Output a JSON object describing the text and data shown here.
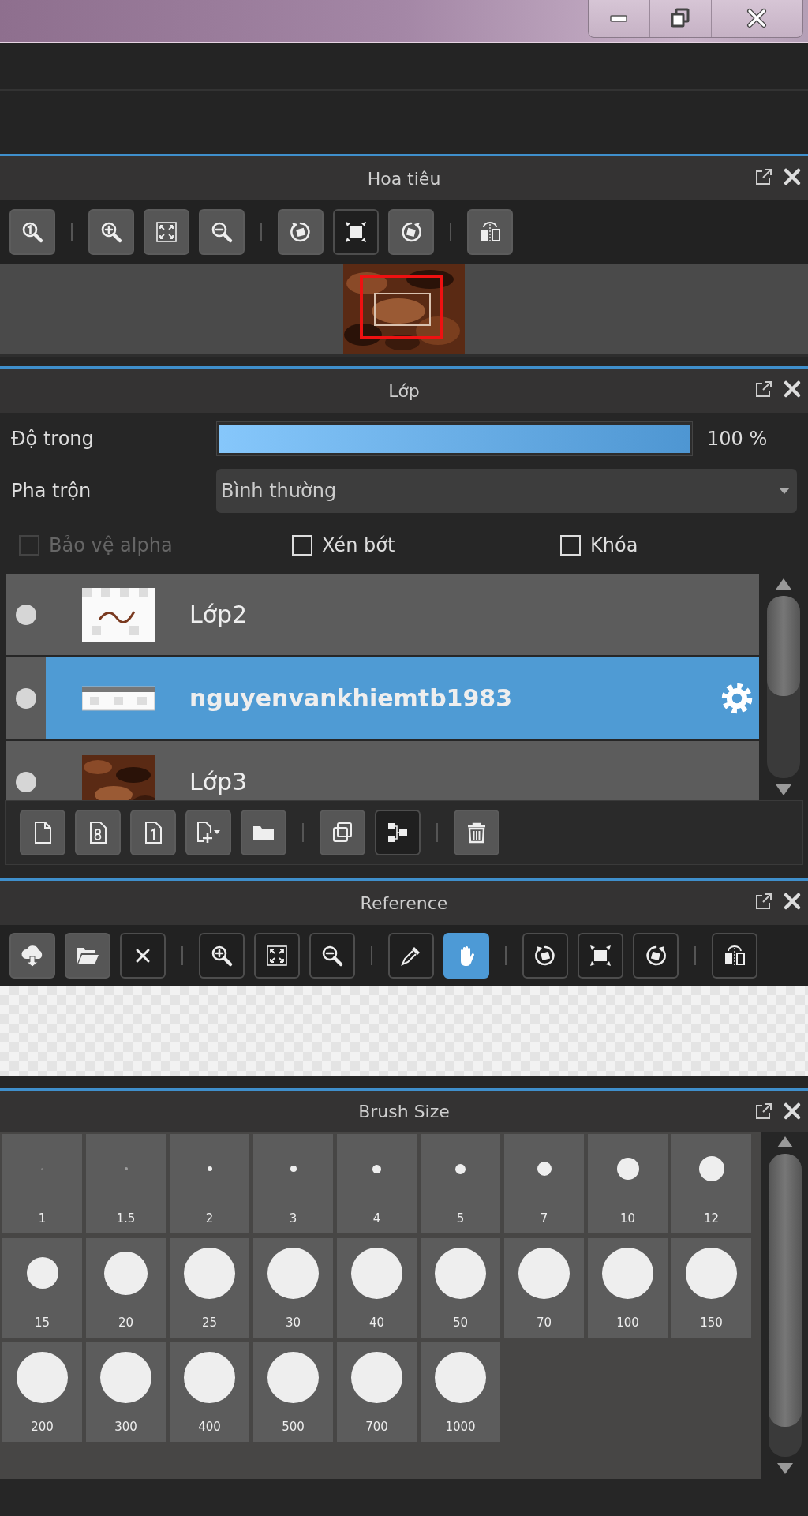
{
  "navigator": {
    "title": "Hoa tiêu",
    "toolbar": [
      [
        {
          "kind": "zoom-actual",
          "pressed": false,
          "selected": false
        }
      ],
      [
        {
          "kind": "zoom-in",
          "pressed": false,
          "selected": false
        },
        {
          "kind": "fit",
          "pressed": false,
          "selected": false
        },
        {
          "kind": "zoom-out",
          "pressed": false,
          "selected": false
        }
      ],
      [
        {
          "kind": "rotate-left",
          "pressed": false,
          "selected": false
        },
        {
          "kind": "fill",
          "pressed": true,
          "selected": false
        },
        {
          "kind": "rotate-right",
          "pressed": false,
          "selected": false
        }
      ],
      [
        {
          "kind": "flip",
          "pressed": false,
          "selected": false
        }
      ]
    ]
  },
  "layers": {
    "title": "Lớp",
    "opacity": {
      "label": "Độ trong",
      "level": 1,
      "reading": "100 %"
    },
    "blend": {
      "label": "Pha trộn",
      "value": "Bình thường"
    },
    "checkboxes": [
      {
        "label": "Bảo vệ alpha",
        "checked": false,
        "disabled": true
      },
      {
        "label": "Xén bớt",
        "checked": false,
        "disabled": false
      },
      {
        "label": "Khóa",
        "checked": false,
        "disabled": false
      }
    ],
    "items": [
      {
        "name": "Lớp2",
        "selected": false
      },
      {
        "name": "nguyenvankhiemtb1983",
        "selected": true
      },
      {
        "name": "Lớp3",
        "selected": false
      }
    ],
    "toolbar": [
      [
        {
          "kind": "new-layer",
          "pressed": false,
          "selected": false
        },
        {
          "kind": "new-8bit-layer",
          "pressed": false,
          "selected": false
        },
        {
          "kind": "new-1bit-layer",
          "pressed": false,
          "selected": false
        },
        {
          "kind": "add-layer-menu",
          "pressed": false,
          "selected": false
        },
        {
          "kind": "folder",
          "pressed": false,
          "selected": false
        }
      ],
      [
        {
          "kind": "duplicate",
          "pressed": false,
          "selected": false
        },
        {
          "kind": "merge",
          "pressed": true,
          "selected": false
        }
      ],
      [
        {
          "kind": "trash",
          "pressed": false,
          "selected": false
        }
      ]
    ]
  },
  "reference": {
    "title": "Reference",
    "toolbar": [
      [
        {
          "kind": "cloud-download",
          "pressed": false,
          "selected": false
        },
        {
          "kind": "folder-open",
          "pressed": false,
          "selected": false
        },
        {
          "kind": "close-x",
          "pressed": true,
          "selected": false
        }
      ],
      [
        {
          "kind": "zoom-in",
          "pressed": true,
          "selected": false
        },
        {
          "kind": "fit",
          "pressed": true,
          "selected": false
        },
        {
          "kind": "zoom-out",
          "pressed": true,
          "selected": false
        }
      ],
      [
        {
          "kind": "eyedropper",
          "pressed": true,
          "selected": false
        },
        {
          "kind": "hand",
          "pressed": false,
          "selected": true
        }
      ],
      [
        {
          "kind": "rotate-left",
          "pressed": true,
          "selected": false
        },
        {
          "kind": "fill",
          "pressed": true,
          "selected": false
        },
        {
          "kind": "rotate-right",
          "pressed": true,
          "selected": false
        }
      ],
      [
        {
          "kind": "flip",
          "pressed": true,
          "selected": false
        }
      ]
    ]
  },
  "brush_size": {
    "title": "Brush Size",
    "sizes": [
      "1",
      "1.5",
      "2",
      "3",
      "4",
      "5",
      "7",
      "10",
      "12",
      "15",
      "20",
      "25",
      "30",
      "40",
      "50",
      "70",
      "100",
      "150",
      "200",
      "300",
      "400",
      "500",
      "700",
      "1000"
    ]
  }
}
